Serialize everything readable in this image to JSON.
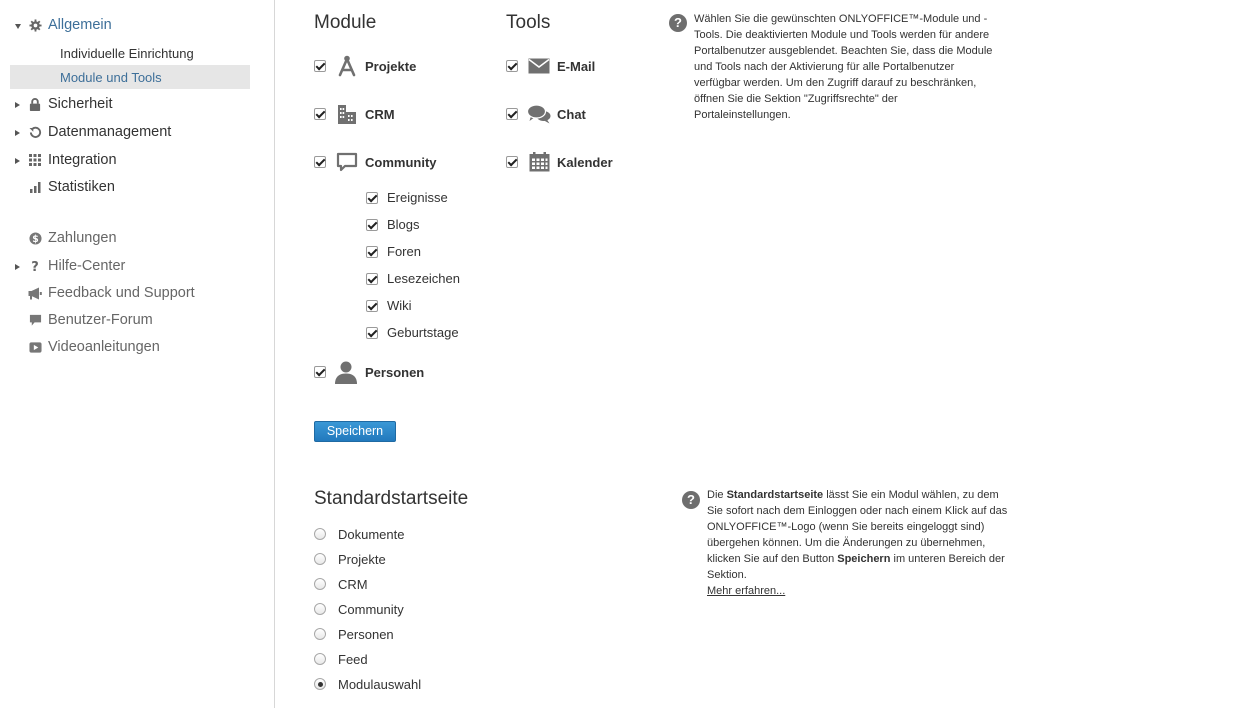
{
  "sidebar": {
    "items": [
      {
        "label": "Allgemein",
        "icon": "gear-icon"
      },
      {
        "label": "Individuelle Einrichtung"
      },
      {
        "label": "Module und Tools"
      },
      {
        "label": "Sicherheit",
        "icon": "lock-icon"
      },
      {
        "label": "Datenmanagement",
        "icon": "restore-icon"
      },
      {
        "label": "Integration",
        "icon": "grid-icon"
      },
      {
        "label": "Statistiken",
        "icon": "bar-chart-icon"
      },
      {
        "label": "Zahlungen",
        "icon": "dollar-icon"
      },
      {
        "label": "Hilfe-Center",
        "icon": "question-icon"
      },
      {
        "label": "Feedback und Support",
        "icon": "megaphone-icon"
      },
      {
        "label": "Benutzer-Forum",
        "icon": "speech-bubble-icon"
      },
      {
        "label": "Videoanleitungen",
        "icon": "play-icon"
      }
    ]
  },
  "modules": {
    "title": "Module",
    "items": [
      {
        "label": "Projekte",
        "checked": true,
        "icon": "compass-icon"
      },
      {
        "label": "CRM",
        "checked": true,
        "icon": "buildings-icon"
      },
      {
        "label": "Community",
        "checked": true,
        "icon": "comment-icon"
      },
      {
        "label": "Personen",
        "checked": true,
        "icon": "person-icon"
      }
    ],
    "community_sub": [
      {
        "label": "Ereignisse",
        "checked": true
      },
      {
        "label": "Blogs",
        "checked": true
      },
      {
        "label": "Foren",
        "checked": true
      },
      {
        "label": "Lesezeichen",
        "checked": true
      },
      {
        "label": "Wiki",
        "checked": true
      },
      {
        "label": "Geburtstage",
        "checked": true
      }
    ]
  },
  "tools": {
    "title": "Tools",
    "items": [
      {
        "label": "E-Mail",
        "checked": true,
        "icon": "envelope-icon"
      },
      {
        "label": "Chat",
        "checked": true,
        "icon": "chat-bubbles-icon"
      },
      {
        "label": "Kalender",
        "checked": true,
        "icon": "calendar-icon"
      }
    ]
  },
  "help1": {
    "text": "Wählen Sie die gewünschten ONLYOFFICE™-Module und -Tools. Die deaktivierten Module und Tools werden für andere Portalbenutzer ausgeblendet. Beachten Sie, dass die Module und Tools nach der Aktivierung für alle Portalbenutzer verfügbar werden. Um den Zugriff darauf zu beschränken, öffnen Sie die Sektion \"Zugriffsrechte\" der Portaleinstellungen."
  },
  "save_button": {
    "label": "Speichern"
  },
  "startpage": {
    "title": "Standardstartseite",
    "options": [
      {
        "label": "Dokumente",
        "selected": false
      },
      {
        "label": "Projekte",
        "selected": false
      },
      {
        "label": "CRM",
        "selected": false
      },
      {
        "label": "Community",
        "selected": false
      },
      {
        "label": "Personen",
        "selected": false
      },
      {
        "label": "Feed",
        "selected": false
      },
      {
        "label": "Modulauswahl",
        "selected": true
      }
    ]
  },
  "help2": {
    "intro": "Die ",
    "bold1": "Standardstartseite",
    "mid": " lässt Sie ein Modul wählen, zu dem Sie sofort nach dem Einloggen oder nach einem Klick auf das ONLYOFFICE™-Logo (wenn Sie bereits eingeloggt sind) übergehen können. Um die Änderungen zu übernehmen, klicken Sie auf den Button ",
    "bold2": "Speichern",
    "end": " im unteren Bereich der Sektion.",
    "link": "Mehr erfahren..."
  },
  "colors": {
    "accent": "#3d6f99",
    "selected_bg": "#e6e6e6",
    "button": "#2a86c8",
    "icon": "#6e6e6e"
  }
}
